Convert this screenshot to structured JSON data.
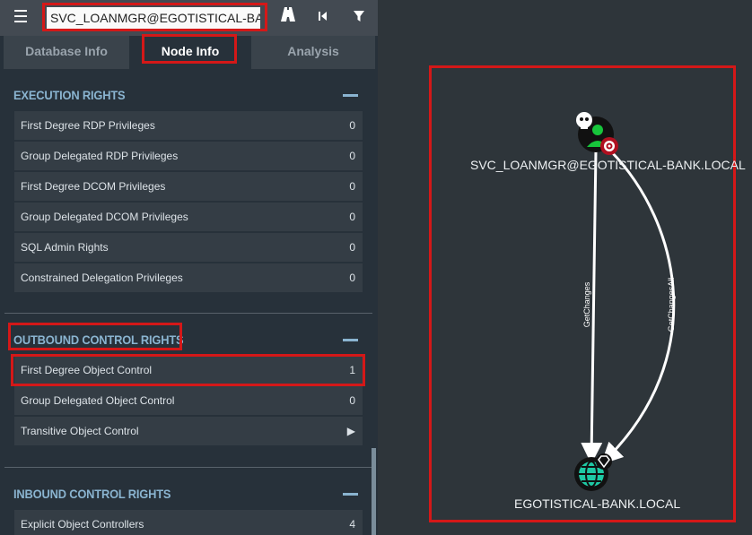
{
  "header": {
    "search_value": "SVC_LOANMGR@EGOTISTICAL-BANK.LOCAL",
    "menu_icon": "hamburger-menu-icon",
    "tools": [
      "road-icon",
      "skip-back-icon",
      "filter-icon"
    ]
  },
  "tabs": [
    {
      "label": "Database Info"
    },
    {
      "label": "Node Info"
    },
    {
      "label": "Analysis"
    }
  ],
  "sections": {
    "execution": {
      "title": "EXECUTION RIGHTS",
      "rows": [
        {
          "label": "First Degree RDP Privileges",
          "value": "0"
        },
        {
          "label": "Group Delegated RDP Privileges",
          "value": "0"
        },
        {
          "label": "First Degree DCOM Privileges",
          "value": "0"
        },
        {
          "label": "Group Delegated DCOM Privileges",
          "value": "0"
        },
        {
          "label": "SQL Admin Rights",
          "value": "0"
        },
        {
          "label": "Constrained Delegation Privileges",
          "value": "0"
        }
      ]
    },
    "outbound": {
      "title": "OUTBOUND CONTROL RIGHTS",
      "rows": [
        {
          "label": "First Degree Object Control",
          "value": "1"
        },
        {
          "label": "Group Delegated Object Control",
          "value": "0"
        },
        {
          "label": "Transitive Object Control",
          "value": "▶"
        }
      ]
    },
    "inbound": {
      "title": "INBOUND CONTROL RIGHTS",
      "rows": [
        {
          "label": "Explicit Object Controllers",
          "value": "4"
        }
      ]
    }
  },
  "graph": {
    "user_node": "SVC_LOANMGR@EGOTISTICAL-BANK.LOCAL",
    "domain_node": "EGOTISTICAL-BANK.LOCAL",
    "edge_1": "GetChanges",
    "edge_2": "GetChangesAll"
  },
  "colors": {
    "highlight": "#d41818",
    "section_title": "#8ab4d0",
    "user_green": "#17c53b",
    "domain_teal": "#1ec9a4"
  }
}
